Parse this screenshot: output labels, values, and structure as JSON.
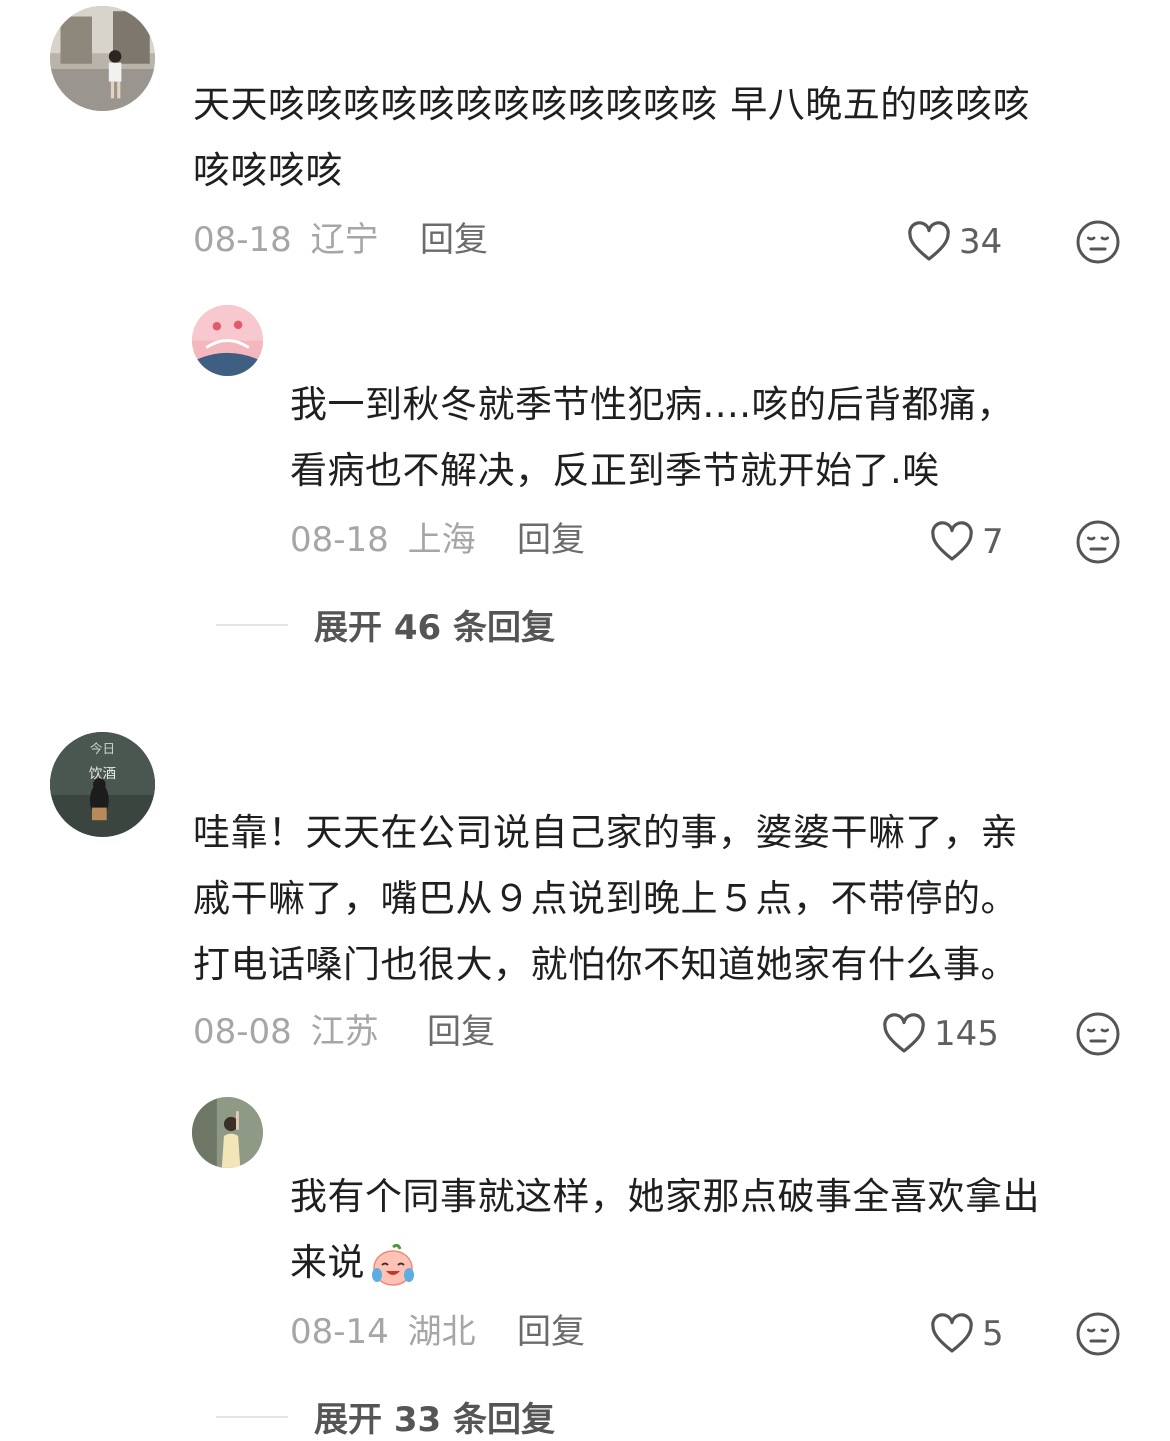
{
  "comments": [
    {
      "text": "天天咳咳咳咳咳咳咳咳咳咳咳咳 早八晚五的咳咳咳咳咳咳咳",
      "line1": "天天咳咳咳咳咳咳咳咳咳咳咳咳 早八晚五的咳咳咳",
      "line2": "咳咳咳咳",
      "date": "08-18",
      "location": "辽宁",
      "reply_label": "回复",
      "likes": "34"
    },
    {
      "line1": "哇靠！天天在公司说自己家的事，婆婆干嘛了，亲",
      "line2": "戚干嘛了，嘴巴从９点说到晚上５点，不带停的。",
      "line3": "打电话嗓门也很大，就怕你不知道她家有什么事。",
      "date": "08-08",
      "location": "江苏",
      "reply_label": "回复",
      "likes": "145"
    }
  ],
  "replies": [
    {
      "line1": "我一到秋冬就季节性犯病....咳的后背都痛，",
      "line2": "看病也不解决，反正到季节就开始了.唉",
      "date": "08-18",
      "location": "上海",
      "reply_label": "回复",
      "likes": "7"
    },
    {
      "line1": "我有个同事就这样，她家那点破事全喜欢拿出",
      "line2": "来说",
      "emoji": "crying-laughing-peach-emoji",
      "date": "08-14",
      "location": "湖北",
      "reply_label": "回复",
      "likes": "5"
    }
  ],
  "expand": [
    {
      "label": "展开 46 条回复"
    },
    {
      "label": "展开 33 条回复"
    }
  ],
  "icons": {
    "like": "heart-outline-icon",
    "dislike": "unamused-face-icon"
  },
  "colors": {
    "text": "#1f1f1f",
    "meta": "#a6a6a6",
    "reply": "#6b6b6b",
    "icon": "#555555"
  }
}
